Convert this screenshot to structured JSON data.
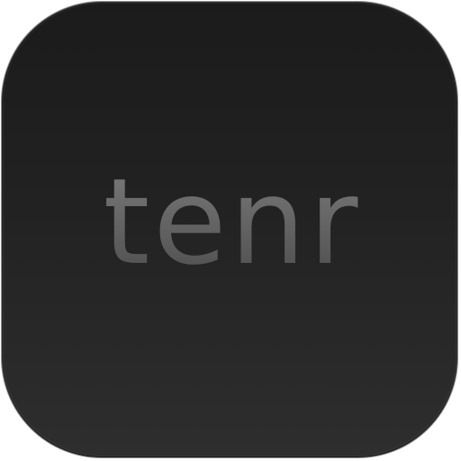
{
  "app": {
    "name": "tenr"
  },
  "colors": {
    "icon_background": "#222222",
    "icon_border": "#8f8f8f",
    "wordmark": "#6b6b6b",
    "page_background": "#ffffff"
  }
}
